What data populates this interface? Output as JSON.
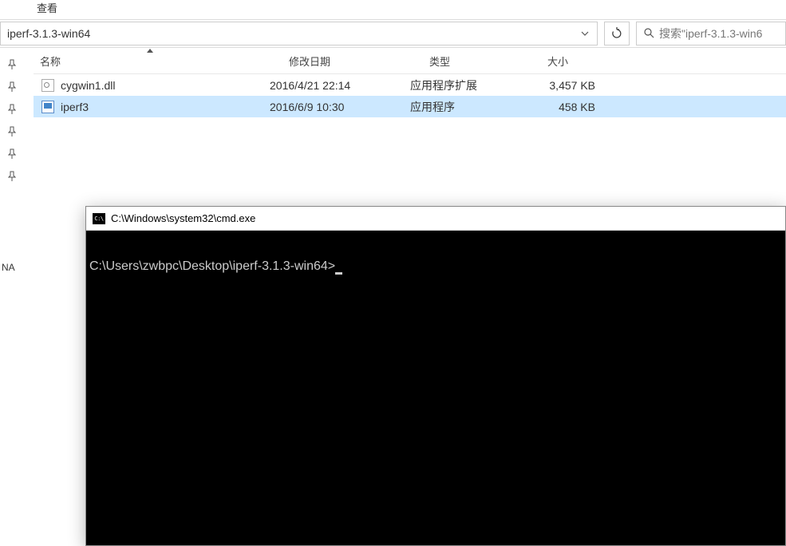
{
  "menu": {
    "view": "查看"
  },
  "address": {
    "path": "iperf-3.1.3-win64"
  },
  "search": {
    "placeholder": "搜索\"iperf-3.1.3-win6"
  },
  "columns": {
    "name": "名称",
    "modified": "修改日期",
    "type": "类型",
    "size": "大小"
  },
  "files": [
    {
      "name": "cygwin1.dll",
      "modified": "2016/4/21 22:14",
      "type": "应用程序扩展",
      "size": "3,457 KB",
      "icon": "dll",
      "selected": false
    },
    {
      "name": "iperf3",
      "modified": "2016/6/9 10:30",
      "type": "应用程序",
      "size": "458 KB",
      "icon": "exe",
      "selected": true
    }
  ],
  "sidebar": {
    "label": "NA"
  },
  "cmd": {
    "title": "C:\\Windows\\system32\\cmd.exe",
    "prompt": "C:\\Users\\zwbpc\\Desktop\\iperf-3.1.3-win64>"
  }
}
